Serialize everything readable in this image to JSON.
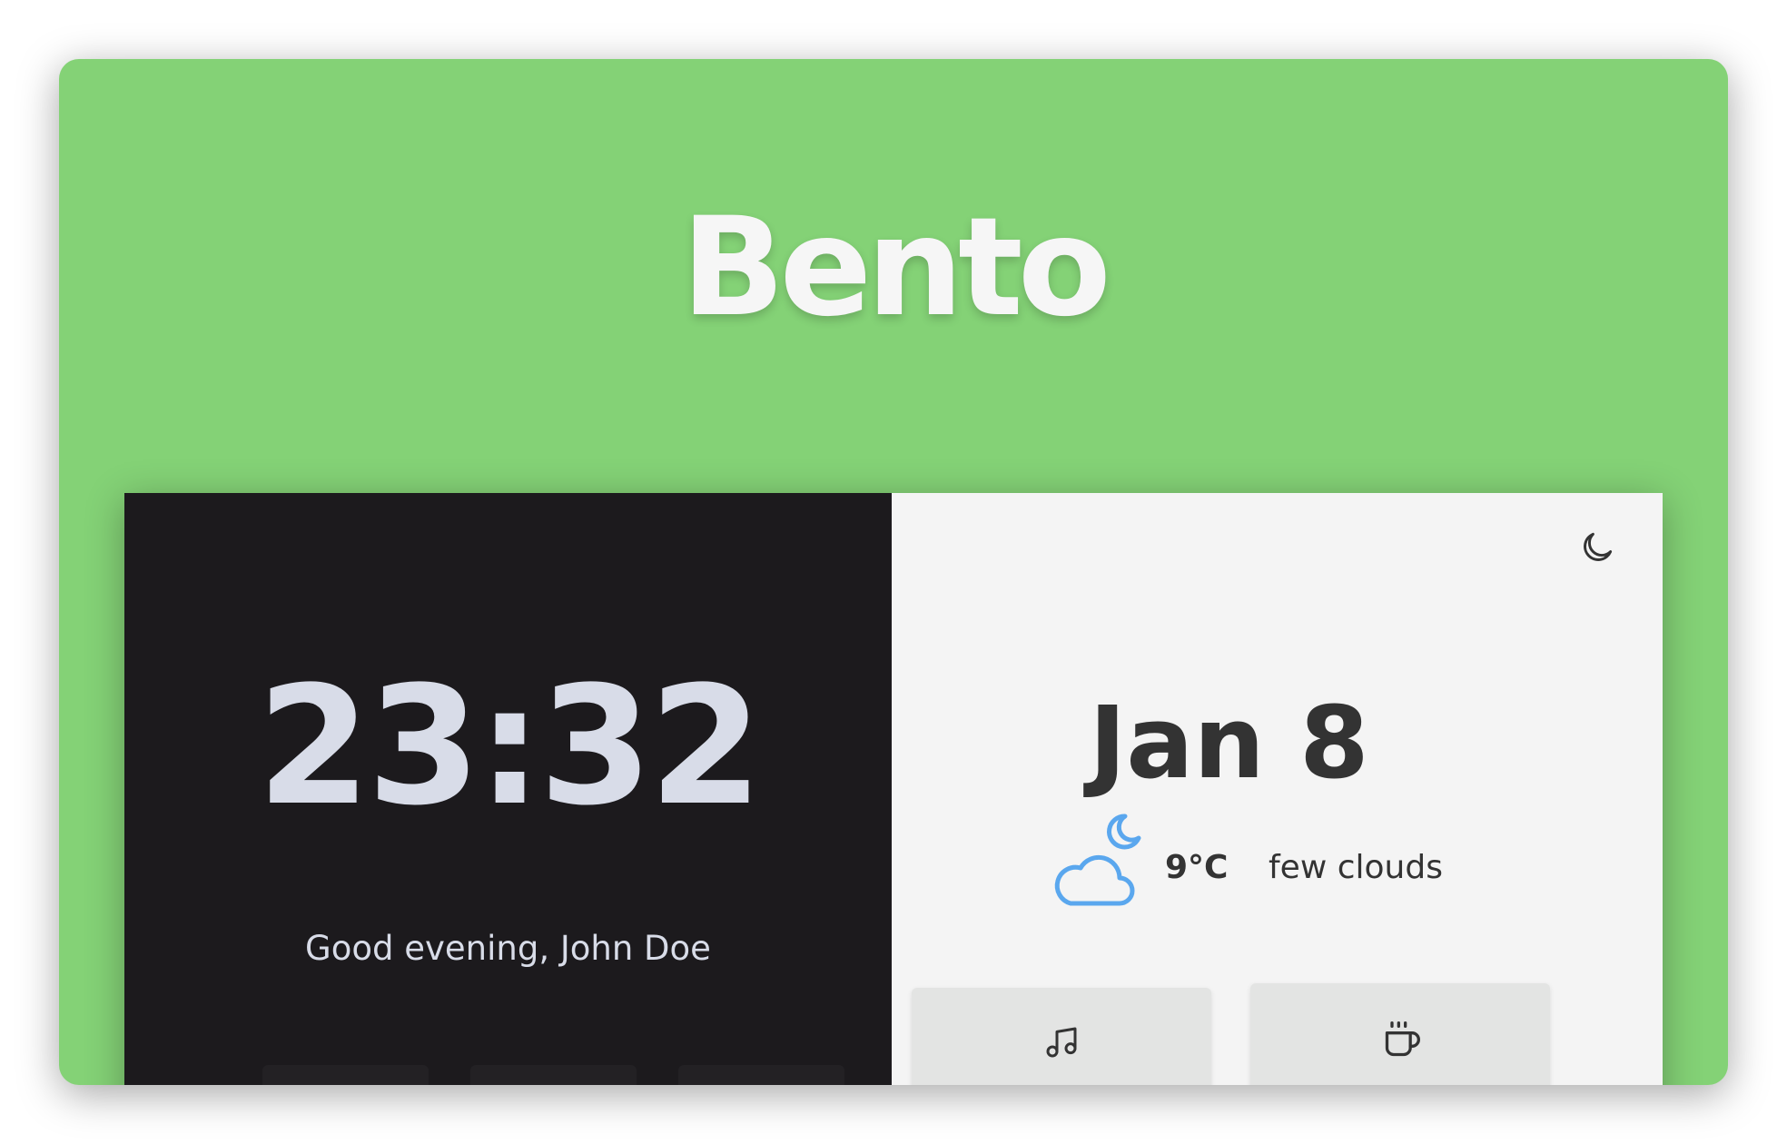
{
  "header": {
    "title": "Bento",
    "background_color": "#84d276"
  },
  "clock_panel": {
    "time": "23:32",
    "greeting": "Good evening, John Doe",
    "background_color": "#1c1a1d",
    "links": [
      {
        "icon": "github-icon"
      },
      {
        "icon": "mail-icon"
      },
      {
        "icon": "trello-icon"
      }
    ]
  },
  "info_panel": {
    "date": "Jan 8",
    "theme_toggle_icon": "moon-icon",
    "weather": {
      "icon": "cloud-moon-icon",
      "temperature": "9°C",
      "condition": "few clouds",
      "icon_color": "#5aa7ee"
    },
    "apps": [
      {
        "icon": "music-icon"
      },
      {
        "icon": "coffee-icon"
      }
    ]
  }
}
